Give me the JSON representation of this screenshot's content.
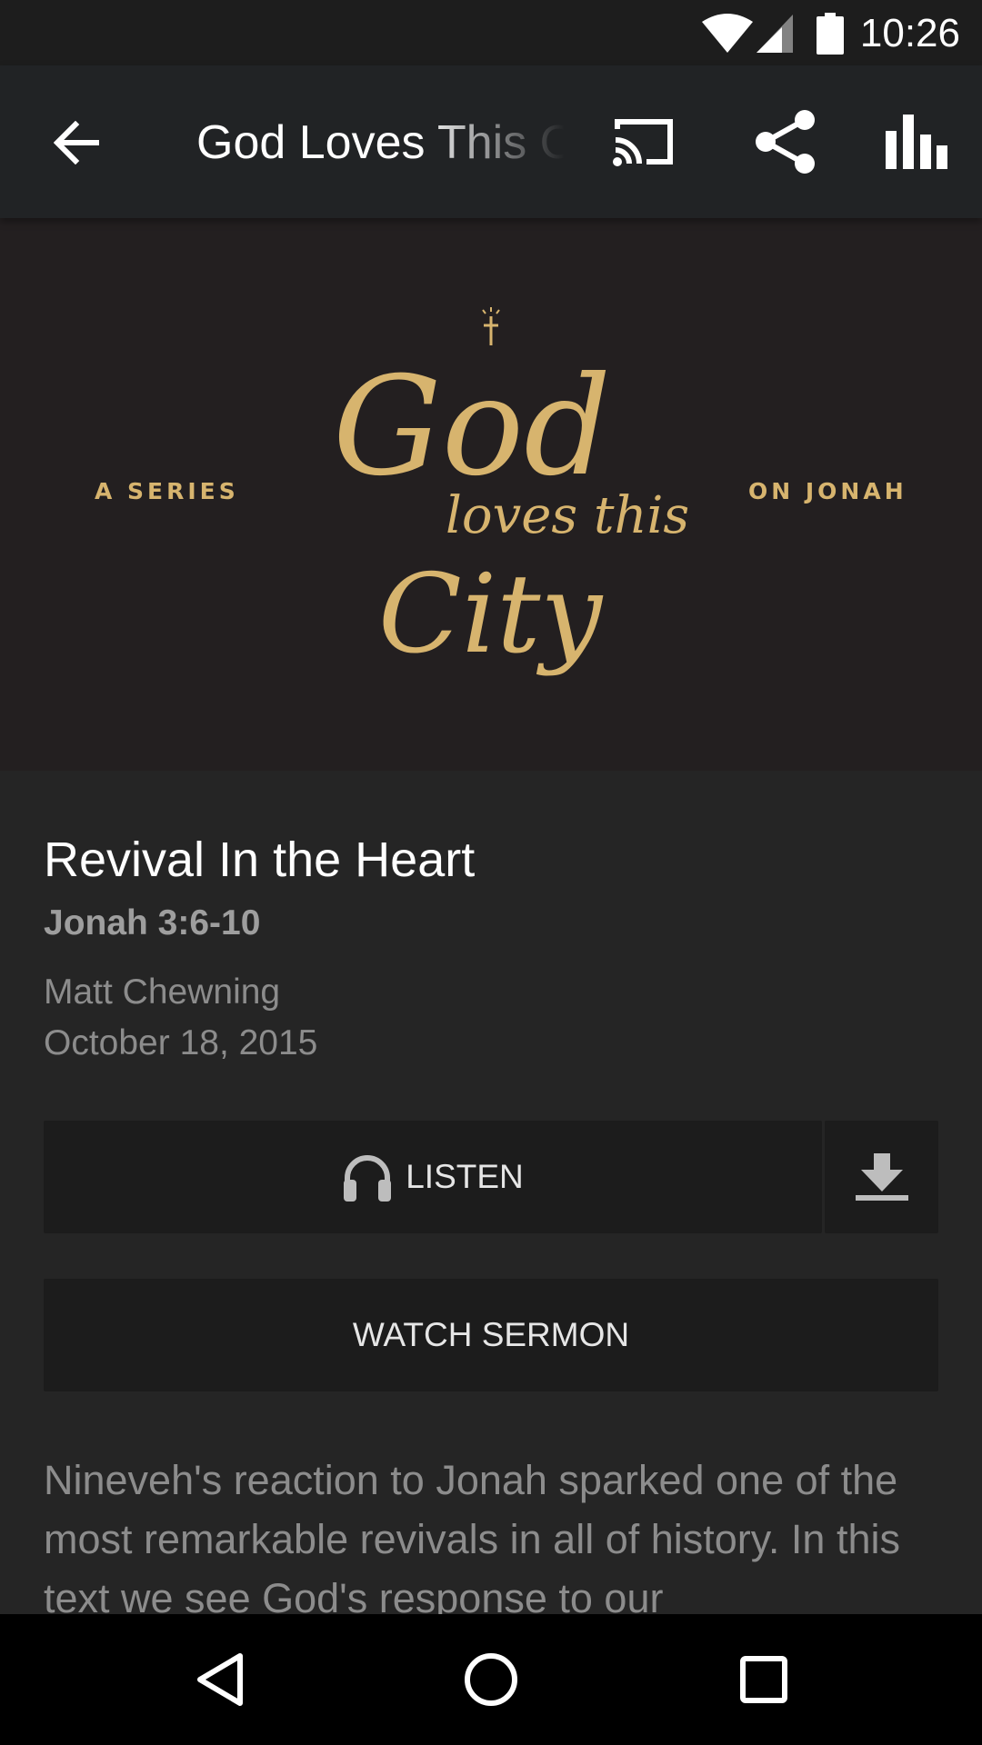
{
  "status_bar": {
    "time": "10:26",
    "icons": [
      "wifi-icon",
      "cellular-signal-icon",
      "battery-icon"
    ]
  },
  "app_bar": {
    "title": "God Loves This City",
    "icons": [
      "back-arrow-icon",
      "cast-icon",
      "share-icon",
      "equalizer-icon"
    ]
  },
  "hero": {
    "left_text": "A SERIES",
    "right_text": "ON JONAH",
    "script_line1": "God",
    "script_line2": "loves this",
    "script_line3": "City",
    "accent_color": "#d7b46e"
  },
  "sermon": {
    "title": "Revival In the Heart",
    "passage": "Jonah 3:6-10",
    "speaker": "Matt Chewning",
    "date": "October 18, 2015",
    "description": "Nineveh's reaction to Jonah sparked one of the most remarkable revivals in all of history. In this text we see God's response to our"
  },
  "actions": {
    "listen_label": "LISTEN",
    "watch_label": "WATCH SERMON"
  },
  "nav_bar": {
    "icons": [
      "back-triangle-icon",
      "home-circle-icon",
      "recents-square-icon"
    ]
  }
}
